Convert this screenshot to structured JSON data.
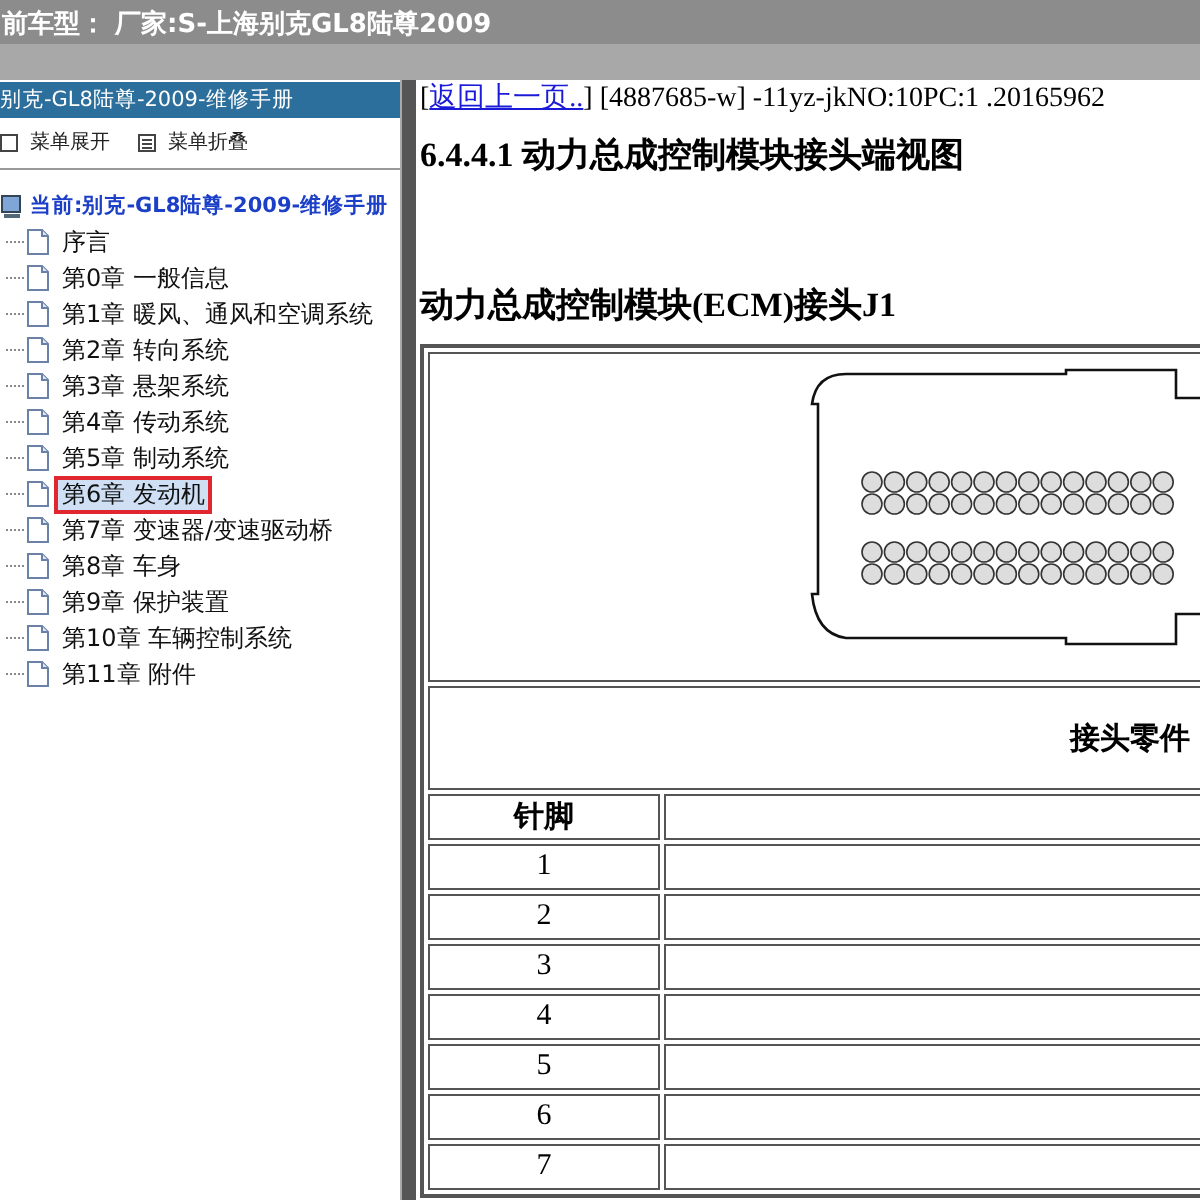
{
  "header": {
    "title": "前车型：  厂家:S-上海别克GL8陆尊2009"
  },
  "sidebar": {
    "title": "别克-GL8陆尊-2009-维修手册",
    "toolbar": [
      {
        "kind": "expand",
        "label": "菜单展开"
      },
      {
        "kind": "collapse",
        "label": "菜单折叠"
      }
    ],
    "root": "当前:别克-GL8陆尊-2009-维修手册",
    "items": [
      {
        "label": "序言",
        "selected": false
      },
      {
        "label": "第0章 一般信息",
        "selected": false
      },
      {
        "label": "第1章 暖风、通风和空调系统",
        "selected": false
      },
      {
        "label": "第2章 转向系统",
        "selected": false
      },
      {
        "label": "第3章 悬架系统",
        "selected": false
      },
      {
        "label": "第4章 传动系统",
        "selected": false
      },
      {
        "label": "第5章 制动系统",
        "selected": false
      },
      {
        "label": "第6章 发动机",
        "selected": true
      },
      {
        "label": "第7章 变速器/变速驱动桥",
        "selected": false
      },
      {
        "label": "第8章 车身",
        "selected": false
      },
      {
        "label": "第9章 保护装置",
        "selected": false
      },
      {
        "label": "第10章 车辆控制系统",
        "selected": false
      },
      {
        "label": "第11章 附件",
        "selected": false
      }
    ]
  },
  "content": {
    "open_bracket": "[",
    "back_link": "返回上一页..",
    "info": "] [4887685-w] -11yz-jkNO:10PC:1 .20165962",
    "section_title": "6.4.4.1 动力总成控制模块接头端视图",
    "connector_title": "动力总成控制模块(ECM)接头J1",
    "parts_heading": "接头零件",
    "table": {
      "columns": [
        "针脚"
      ],
      "rows": [
        "1",
        "2",
        "3",
        "4",
        "5",
        "6",
        "7"
      ]
    }
  }
}
